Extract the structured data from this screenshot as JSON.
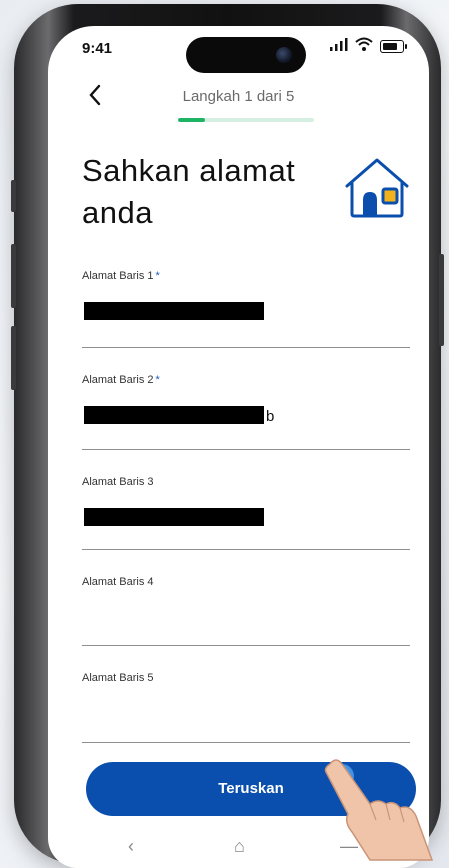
{
  "status_bar": {
    "time": "9:41",
    "signal": "📶",
    "wifi": "◠"
  },
  "header": {
    "back_icon": "‹",
    "step_text": "Langkah 1 dari 5",
    "progress": 0.2
  },
  "page": {
    "title": "Sahkan alamat anda",
    "icon": "house-icon"
  },
  "fields": [
    {
      "label": "Alamat Baris 1",
      "required": "*",
      "value": "",
      "redacted": true,
      "tail": ""
    },
    {
      "label": "Alamat Baris 2",
      "required": "*",
      "value": "",
      "redacted": true,
      "tail": "b"
    },
    {
      "label": "Alamat Baris 3",
      "required": "",
      "value": "",
      "redacted": true,
      "tail": ""
    },
    {
      "label": "Alamat Baris 4",
      "required": "",
      "value": "",
      "redacted": false,
      "tail": ""
    },
    {
      "label": "Alamat Baris 5",
      "required": "",
      "value": "",
      "redacted": false,
      "tail": ""
    }
  ],
  "cta": {
    "label": "Teruskan"
  },
  "nav_bar": {
    "back": "‹",
    "home": "⌂",
    "recent": "—"
  },
  "colors": {
    "primary": "#0a4fae",
    "progress": "#1eb466",
    "accent_yellow": "#f2b21b"
  }
}
